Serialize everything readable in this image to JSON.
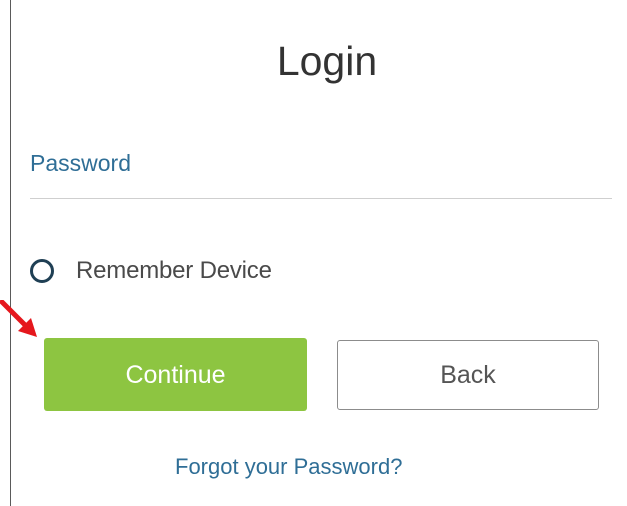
{
  "login": {
    "title": "Login",
    "password_label": "Password",
    "password_value": "",
    "remember_device_label": "Remember Device",
    "remember_device_checked": false,
    "continue_label": "Continue",
    "back_label": "Back",
    "forgot_password_link": "Forgot your Password?"
  },
  "annotation": {
    "arrow_icon": "red-arrow-icon",
    "arrow_color": "#e5171d"
  },
  "colors": {
    "accent": "#8dc541",
    "link": "#2f6e96",
    "text": "#333333"
  }
}
